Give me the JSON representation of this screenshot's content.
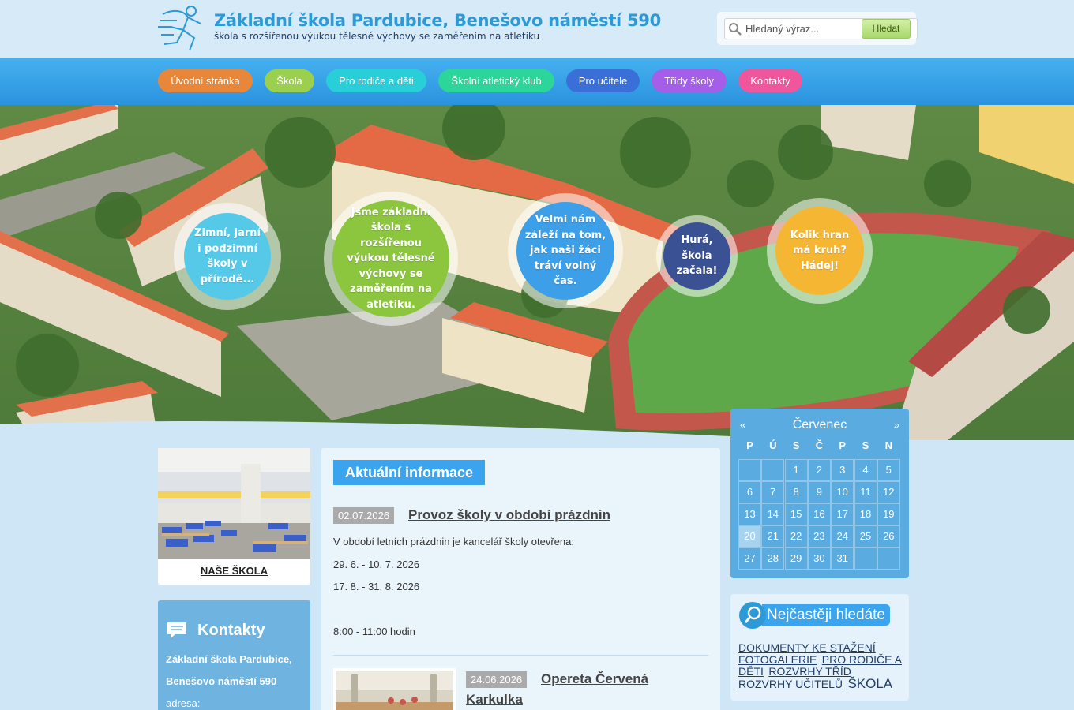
{
  "header": {
    "title": "Základní škola Pardubice, Benešovo náměstí 590",
    "subtitle": "škola s rozšířenou výukou tělesné výchovy se zaměřením na atletiku"
  },
  "search": {
    "placeholder": "Hledaný výraz...",
    "button": "Hledat"
  },
  "nav": [
    {
      "label": "Úvodní stránka",
      "color": "#e8873a"
    },
    {
      "label": "Škola",
      "color": "#9bd04e"
    },
    {
      "label": "Pro rodiče a děti",
      "color": "#29cfd8"
    },
    {
      "label": "Školní atletický klub",
      "color": "#2cd59a"
    },
    {
      "label": "Pro učitele",
      "color": "#3b6fd8"
    },
    {
      "label": "Třídy školy",
      "color": "#a55ee8"
    },
    {
      "label": "Kontakty",
      "color": "#f0569c"
    }
  ],
  "bubbles": [
    {
      "text": "Zimní, jarní i podzimní školy v přírodě...",
      "color": "#56c9e8"
    },
    {
      "text": "Jsme základní škola s rozšířenou výukou tělesné výchovy se zaměřením na atletiku.",
      "color": "#8cc63f"
    },
    {
      "text": "Velmi nám záleží na tom, jak naši žáci tráví volný čas.",
      "color": "#3c9fe8"
    },
    {
      "text": "Hurá, škola začala!",
      "color": "#3a5294"
    },
    {
      "text": "Kolik hran má kruh? Hádej!",
      "color": "#f5b733"
    }
  ],
  "sidebar": {
    "school_caption": "NAŠE ŠKOLA",
    "contacts_title": "Kontakty",
    "contacts_lines": [
      "Základní škola Pardubice,",
      "Benešovo náměstí 590",
      "adresa:"
    ]
  },
  "main": {
    "heading": "Aktuální informace",
    "articles": [
      {
        "date": "02.07.2026",
        "title": "Provoz školy v období prázdnin",
        "lines": [
          "V období letních prázdnin je kancelář školy otevřena:",
          "29. 6. - 10. 7. 2026",
          "17. 8. - 31. 8. 2026",
          "8:00 - 11:00 hodin"
        ]
      },
      {
        "date": "24.06.2026",
        "title_line1": "Opereta Červená",
        "title_line2": "Karkulka"
      }
    ]
  },
  "calendar": {
    "prev": "«",
    "next": "»",
    "month": "Červenec",
    "weekdays": [
      "P",
      "Ú",
      "S",
      "Č",
      "P",
      "S",
      "N"
    ],
    "weeks": [
      [
        "",
        "",
        "1",
        "2",
        "3",
        "4",
        "5"
      ],
      [
        "6",
        "7",
        "8",
        "9",
        "10",
        "11",
        "12"
      ],
      [
        "13",
        "14",
        "15",
        "16",
        "17",
        "18",
        "19"
      ],
      [
        "20",
        "21",
        "22",
        "23",
        "24",
        "25",
        "26"
      ],
      [
        "27",
        "28",
        "29",
        "30",
        "31",
        "",
        ""
      ]
    ],
    "highlight": "20"
  },
  "searched": {
    "title": "Nejčastěji hledáte",
    "tags": [
      "DOKUMENTY KE STAŽENÍ",
      "FOTOGALERIE",
      "PRO RODIČE A DĚTI",
      "ROZVRHY TŘÍD",
      "ROZVRHY UČITELŮ",
      "ŠKOLA"
    ]
  }
}
